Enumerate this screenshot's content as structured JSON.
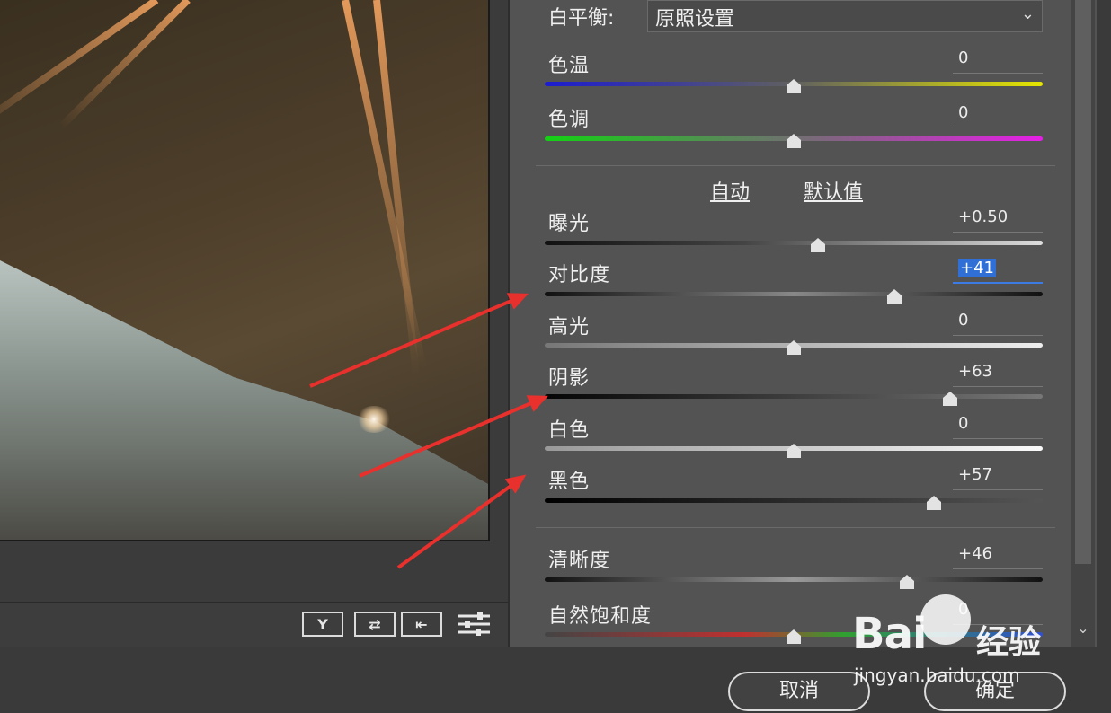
{
  "white_balance": {
    "label": "白平衡:",
    "value": "原照设置"
  },
  "links": {
    "auto": "自动",
    "default": "默认值"
  },
  "sliders": [
    {
      "id": "temperature",
      "label": "色温",
      "value": "0"
    },
    {
      "id": "tint",
      "label": "色调",
      "value": "0"
    },
    {
      "id": "exposure",
      "label": "曝光",
      "value": "+0.50"
    },
    {
      "id": "contrast",
      "label": "对比度",
      "value": "+41"
    },
    {
      "id": "highlights",
      "label": "高光",
      "value": "0"
    },
    {
      "id": "shadows",
      "label": "阴影",
      "value": "+63"
    },
    {
      "id": "whites",
      "label": "白色",
      "value": "0"
    },
    {
      "id": "blacks",
      "label": "黑色",
      "value": "+57"
    },
    {
      "id": "clarity",
      "label": "清晰度",
      "value": "+46"
    },
    {
      "id": "vibrance",
      "label": "自然饱和度",
      "value": "0"
    }
  ],
  "preview_tools": [
    {
      "id": "yy",
      "label": "Y",
      "icon": "before-after-icon"
    },
    {
      "id": "swap",
      "label": "⇄",
      "icon": "swap-icon"
    },
    {
      "id": "copy",
      "label": "⇤",
      "icon": "copy-settings-icon"
    },
    {
      "id": "settings",
      "label": "",
      "icon": "sliders-icon"
    }
  ],
  "buttons": {
    "cancel": "取消",
    "ok": "确定"
  },
  "watermark": {
    "brand": "Bai",
    "product": "经验",
    "url": "jingyan.baidu.com"
  },
  "colors": {
    "panel_bg": "#535353",
    "arrow": "#e8302c",
    "selection": "#2f6fd6"
  }
}
